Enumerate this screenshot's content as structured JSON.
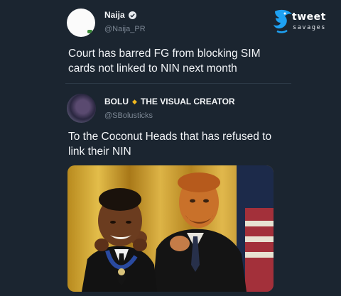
{
  "watermark": {
    "brand": "tweet",
    "tagline": "savages",
    "colors": {
      "icon": "#1ea1f2",
      "text": "#ffffff"
    }
  },
  "tweets": [
    {
      "name": "Naija",
      "handle": "@Naija_PR",
      "verified": true,
      "text": "Court has barred FG from blocking SIM cards not linked to NIN next month"
    },
    {
      "name": "BOLU",
      "name_separator": "◆",
      "name_suffix": "THE VISUAL CREATOR",
      "handle": "@SBolusticks",
      "text": "To the Coconut Heads that has refused to link their NIN",
      "media": {
        "kind": "meme-photo",
        "description_icon": "medal-ceremony-image"
      }
    }
  ],
  "colors": {
    "background": "#1b2530",
    "text_primary": "#f2f4f7",
    "text_secondary": "#7c8794",
    "diamond": "#f0b81e"
  }
}
